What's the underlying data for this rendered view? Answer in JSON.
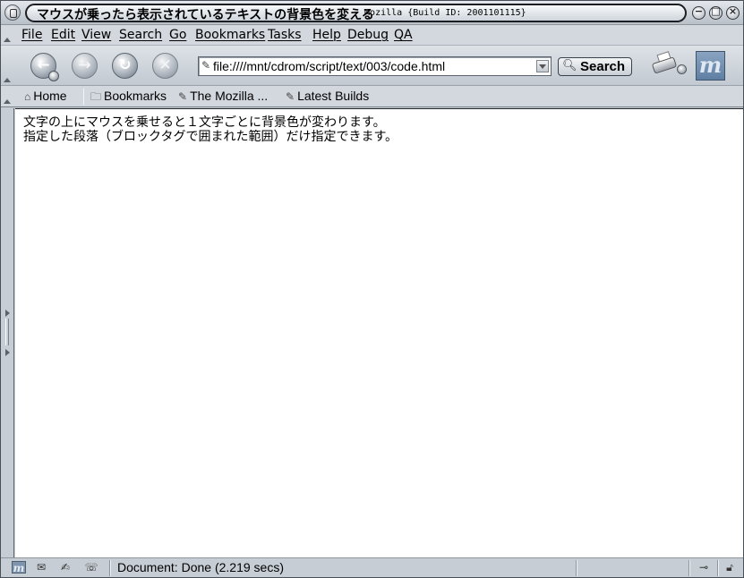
{
  "window": {
    "title": "マウスが乗ったら表示されているテキストの背景色を変える",
    "app_title": "- Mozilla {Build ID: 2001101115}",
    "minimize_glyph": "−",
    "maximize_glyph": "□",
    "close_glyph": "×"
  },
  "menubar": {
    "items": [
      "File",
      "Edit",
      "View",
      "Search",
      "Go",
      "Bookmarks",
      "Tasks",
      "Help",
      "Debug",
      "QA"
    ]
  },
  "navbar": {
    "back_glyph": "←",
    "forward_glyph": "→",
    "reload_glyph": "↻",
    "stop_glyph": "✕",
    "url": "file:////mnt/cdrom/script/text/003/code.html",
    "search_label": "Search",
    "throbber_letter": "m"
  },
  "personal_toolbar": {
    "home": "Home",
    "bookmarks": "Bookmarks",
    "mozilla": "The Mozilla ...",
    "latest_builds": "Latest Builds"
  },
  "content": {
    "line1": "文字の上にマウスを乗せると１文字ごとに背景色が変わります。",
    "line2": "指定した段落（ブロックタグで囲まれた範囲）だけ指定できます。"
  },
  "statusbar": {
    "text": "Document: Done (2.219 secs)"
  },
  "colors": {
    "content_bg": "#ffffff",
    "chrome": "#c7cdd4",
    "accent": "#7f95ae"
  },
  "icons": {
    "back": "back-arrow-icon",
    "forward": "forward-arrow-icon",
    "reload": "reload-icon",
    "stop": "stop-icon",
    "search": "magnifier-icon",
    "print": "printer-icon",
    "home": "home-icon",
    "bookmarks": "folder-icon",
    "bookmark_link": "bookmark-link-icon",
    "status_mozilla": "mozilla-icon",
    "status_mail": "mail-icon",
    "status_composer": "composer-icon",
    "status_chat": "chat-icon",
    "online": "online-plug-icon",
    "security": "unlocked-padlock-icon"
  }
}
